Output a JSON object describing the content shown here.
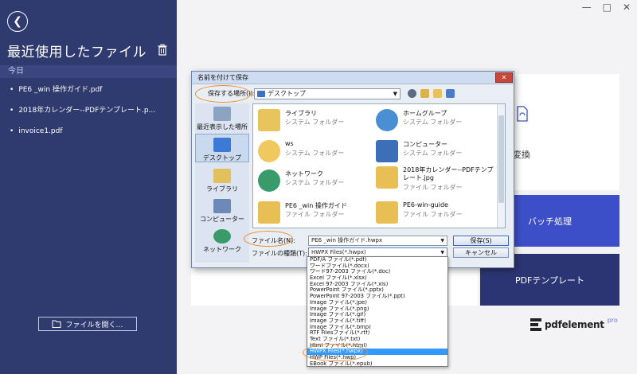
{
  "sidebar": {
    "title": "最近使用したファイル",
    "section": "今日",
    "files": [
      "PE6 _win 操作ガイド.pdf",
      "2018年カレンダー--PDFテンプレート.p...",
      "invoice1.pdf"
    ],
    "open_button": "ファイルを開く…"
  },
  "main": {
    "convert_label": "変換",
    "batch_label": "バッチ処理",
    "template_label": "PDFテンプレート",
    "logo_text": "pdfelement",
    "logo_pro": "pro"
  },
  "dialog": {
    "title": "名前を付けて保存",
    "close_symbol": "✕",
    "save_in_label": "保存する場所(I):",
    "save_in_value": "デスクトップ",
    "places": [
      "最近表示した場所",
      "デスクトップ",
      "ライブラリ",
      "コンピューター",
      "ネットワーク"
    ],
    "items": [
      {
        "name": "ライブラリ",
        "sub": "システム フォルダー"
      },
      {
        "name": "ホームグループ",
        "sub": "システム フォルダー"
      },
      {
        "name": "ws",
        "sub": "システム フォルダー"
      },
      {
        "name": "コンピューター",
        "sub": "システム フォルダー"
      },
      {
        "name": "ネットワーク",
        "sub": "システム フォルダー"
      },
      {
        "name": "2018年カレンダー--PDFテンプレート.jpg",
        "sub": "ファイル フォルダー"
      },
      {
        "name": "PE6 _win 操作ガイド",
        "sub": "ファイル フォルダー"
      },
      {
        "name": "PE6-win-guide",
        "sub": "ファイル フォルダー"
      }
    ],
    "filename_label": "ファイル名(N):",
    "filename_value": "PE6 _win 操作ガイド.hwpx",
    "filetype_label": "ファイルの種類(T):",
    "filetype_value": "HWPX Files(*.hwpx)",
    "save_button": "保存(S)",
    "cancel_button": "キャンセル"
  },
  "dropdown_options": [
    "PDF/A ファイル(*.pdf)",
    "ワードファイル(*.docx)",
    "ワード97-2003 ファイル(*.doc)",
    "Excel ファイル(*.xlsx)",
    "Excel 97-2003 ファイル(*.xls)",
    "PowerPoint ファイル(*.pptx)",
    "PowerPoint 97-2003 ファイル(*.ppt)",
    "Image ファイル(*.jpe)",
    "Image ファイル(*.png)",
    "Image ファイル(*.gif)",
    "Image ファイル(*.tiff)",
    "Image ファイル(*.bmp)",
    "RTF Filesファイル(*.rtf)",
    "Text ファイル(*.txt)",
    "Html ファイル(*.html)",
    "HWPX Files(*.hwpx)",
    "HWP Files(*.hwp)",
    "EBook ファイル(*.epub)"
  ],
  "window_controls": [
    "—",
    "□",
    "✕"
  ]
}
